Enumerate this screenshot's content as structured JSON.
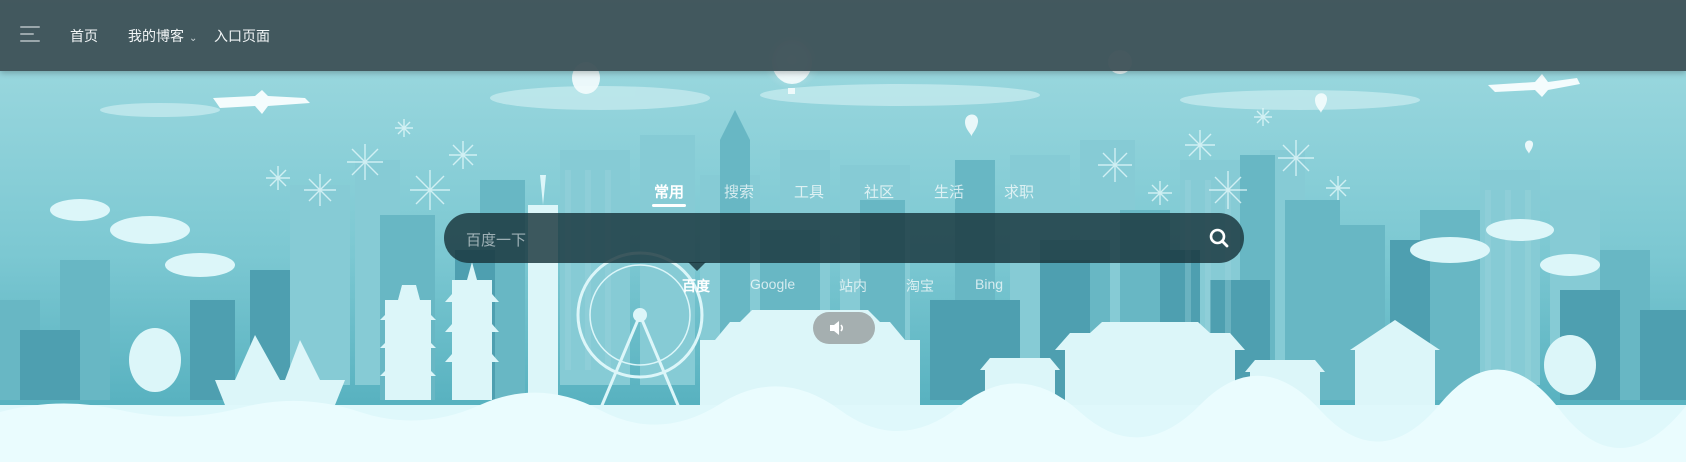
{
  "colors": {
    "sky_top": "#a3dce2",
    "sky_bottom": "#4aa9b9",
    "skyline_far": "#7cc4cf",
    "skyline_mid": "#66b5c2",
    "skyline_near": "#4a9eae",
    "foreground_white": "#dff8fb",
    "topbar_bg": "#3e5258",
    "search_bg": "#18343c"
  },
  "topbar": {
    "menu_icon": "hamburger-menu-icon",
    "nav": [
      {
        "label": "首页"
      },
      {
        "label": "我的博客",
        "has_dropdown": true,
        "dropdown_icon": "chevron-down-icon"
      },
      {
        "label": "入口页面"
      }
    ]
  },
  "search": {
    "categories": [
      {
        "label": "常用",
        "active": true
      },
      {
        "label": "搜索"
      },
      {
        "label": "工具"
      },
      {
        "label": "社区"
      },
      {
        "label": "生活"
      },
      {
        "label": "求职"
      }
    ],
    "placeholder": "百度一下",
    "value": "",
    "button_icon": "search-icon",
    "engines": [
      {
        "label": "百度",
        "active": true
      },
      {
        "label": "Google"
      },
      {
        "label": "站内"
      },
      {
        "label": "淘宝"
      },
      {
        "label": "Bing"
      }
    ]
  },
  "sound_toggle": {
    "icon": "speaker-icon"
  }
}
